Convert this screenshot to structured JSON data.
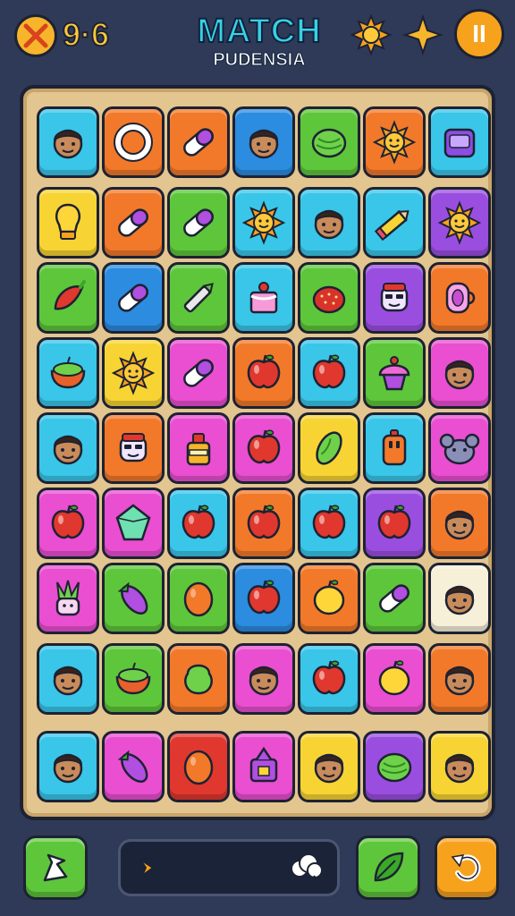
{
  "hud": {
    "score_icon": "crossed-swords-icon",
    "score": "9·6",
    "title": "MATCH",
    "subtitle": "PUDENSIA",
    "buttons": [
      {
        "name": "sun-gear-icon",
        "color": "#f7a21d"
      },
      {
        "name": "sparkle-star-icon",
        "color": "#f7b52c"
      }
    ],
    "pause_label": "II"
  },
  "board": {
    "colors": {
      "cyan": "#39c6e8",
      "orange": "#f2792a",
      "blue": "#2b8ce0",
      "green": "#5ec63a",
      "yellow": "#f7d433",
      "purple": "#9a4ee0",
      "pink": "#e94fd0",
      "red": "#e0382e",
      "cream": "#f6f0d8"
    },
    "rows": [
      [
        {
          "bg": "cyan",
          "icon": "face-icon"
        },
        {
          "bg": "orange",
          "icon": "ring-icon"
        },
        {
          "bg": "orange",
          "icon": "pill-icon"
        },
        {
          "bg": "blue",
          "icon": "face-icon"
        },
        {
          "bg": "green",
          "icon": "melon-icon"
        },
        {
          "bg": "orange",
          "icon": "sun-icon"
        },
        {
          "bg": "cyan",
          "icon": "cup-icon"
        }
      ],
      [
        {
          "bg": "yellow",
          "icon": "bulb-icon"
        },
        {
          "bg": "orange",
          "icon": "pill-icon"
        },
        {
          "bg": "green",
          "icon": "pill-icon"
        },
        {
          "bg": "cyan",
          "icon": "sun-icon"
        },
        {
          "bg": "cyan",
          "icon": "face-icon"
        },
        {
          "bg": "cyan",
          "icon": "pencil-icon"
        },
        {
          "bg": "purple",
          "icon": "sun-icon"
        }
      ],
      [
        {
          "bg": "green",
          "icon": "chili-icon"
        },
        {
          "bg": "blue",
          "icon": "pill-icon"
        },
        {
          "bg": "green",
          "icon": "pen-icon"
        },
        {
          "bg": "cyan",
          "icon": "cake-icon"
        },
        {
          "bg": "green",
          "icon": "strawberry-icon"
        },
        {
          "bg": "purple",
          "icon": "robot-icon"
        },
        {
          "bg": "orange",
          "icon": "mug-icon"
        }
      ],
      [
        {
          "bg": "cyan",
          "icon": "bowl-icon"
        },
        {
          "bg": "yellow",
          "icon": "sun-icon"
        },
        {
          "bg": "pink",
          "icon": "pill-icon"
        },
        {
          "bg": "orange",
          "icon": "apple-icon"
        },
        {
          "bg": "cyan",
          "icon": "apple-icon"
        },
        {
          "bg": "green",
          "icon": "cupcake-icon"
        },
        {
          "bg": "pink",
          "icon": "face-icon"
        }
      ],
      [
        {
          "bg": "cyan",
          "icon": "face-icon"
        },
        {
          "bg": "orange",
          "icon": "robot-icon"
        },
        {
          "bg": "pink",
          "icon": "bottle-icon"
        },
        {
          "bg": "pink",
          "icon": "apple-icon"
        },
        {
          "bg": "yellow",
          "icon": "pickle-icon"
        },
        {
          "bg": "cyan",
          "icon": "lantern-icon"
        },
        {
          "bg": "pink",
          "icon": "monster-icon"
        }
      ],
      [
        {
          "bg": "pink",
          "icon": "apple-icon"
        },
        {
          "bg": "pink",
          "icon": "gem-icon"
        },
        {
          "bg": "cyan",
          "icon": "apple-icon"
        },
        {
          "bg": "orange",
          "icon": "apple-icon"
        },
        {
          "bg": "cyan",
          "icon": "apple-icon"
        },
        {
          "bg": "purple",
          "icon": "apple-icon"
        },
        {
          "bg": "orange",
          "icon": "face-icon"
        }
      ],
      [
        {
          "bg": "pink",
          "icon": "plant-icon"
        },
        {
          "bg": "green",
          "icon": "eggplant-icon"
        },
        {
          "bg": "green",
          "icon": "egg-icon"
        },
        {
          "bg": "blue",
          "icon": "apple-icon"
        },
        {
          "bg": "orange",
          "icon": "lemon-icon"
        },
        {
          "bg": "green",
          "icon": "pill-icon"
        },
        {
          "bg": "cream",
          "icon": "face-icon"
        }
      ],
      [
        {
          "bg": "cyan",
          "icon": "face-icon"
        },
        {
          "bg": "green",
          "icon": "bowl-icon"
        },
        {
          "bg": "orange",
          "icon": "blob-icon"
        },
        {
          "bg": "pink",
          "icon": "face-icon"
        },
        {
          "bg": "cyan",
          "icon": "apple-icon"
        },
        {
          "bg": "pink",
          "icon": "lemon-icon"
        },
        {
          "bg": "orange",
          "icon": "face-icon"
        }
      ],
      [
        {
          "bg": "cyan",
          "icon": "face-icon"
        },
        {
          "bg": "pink",
          "icon": "eggplant-icon"
        },
        {
          "bg": "red",
          "icon": "egg-icon"
        },
        {
          "bg": "pink",
          "icon": "bag-icon"
        },
        {
          "bg": "yellow",
          "icon": "face-icon"
        },
        {
          "bg": "purple",
          "icon": "melon-icon"
        },
        {
          "bg": "yellow",
          "icon": "face-icon"
        }
      ]
    ]
  },
  "footer": {
    "hint_button": {
      "icon": "hand-pointer-icon",
      "color": "#5ec63a"
    },
    "progress": {
      "left_icon": "flag-icon",
      "right_icon": "cloud-icon",
      "fill_fraction": 0.0
    },
    "shuffle_button": {
      "icon": "leaf-icon",
      "color": "#5ec63a"
    },
    "undo_button": {
      "icon": "undo-arrow-icon",
      "color": "#f7a21d"
    }
  }
}
